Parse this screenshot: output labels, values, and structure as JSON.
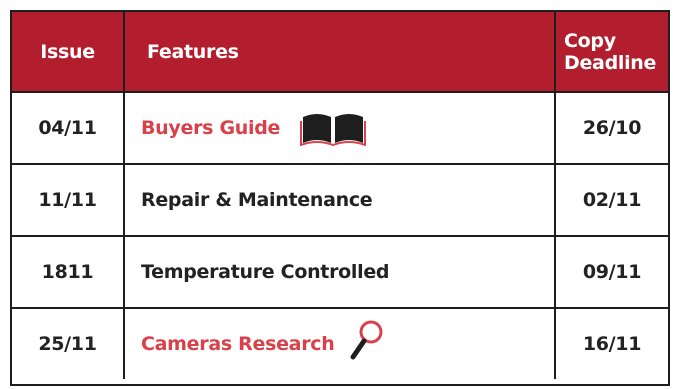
{
  "header": {
    "issue": "Issue",
    "features": "Features",
    "copy_deadline_line1": "Copy",
    "copy_deadline_line2": "Deadline"
  },
  "rows": [
    {
      "issue": "04/11",
      "feature": "Buyers Guide",
      "deadline": "26/10",
      "highlight": true,
      "icon": "open-book-icon"
    },
    {
      "issue": "11/11",
      "feature": "Repair & Maintenance",
      "deadline": "02/11",
      "highlight": false
    },
    {
      "issue": "1811",
      "feature": "Temperature Controlled",
      "deadline": "09/11",
      "highlight": false
    },
    {
      "issue": "25/11",
      "feature": "Cameras Research",
      "deadline": "16/11",
      "highlight": true,
      "icon": "magnifying-glass-icon"
    }
  ],
  "colors": {
    "header_bg": "#b31e2e",
    "highlight_text": "#d9414a",
    "border": "#1e1e1e"
  }
}
